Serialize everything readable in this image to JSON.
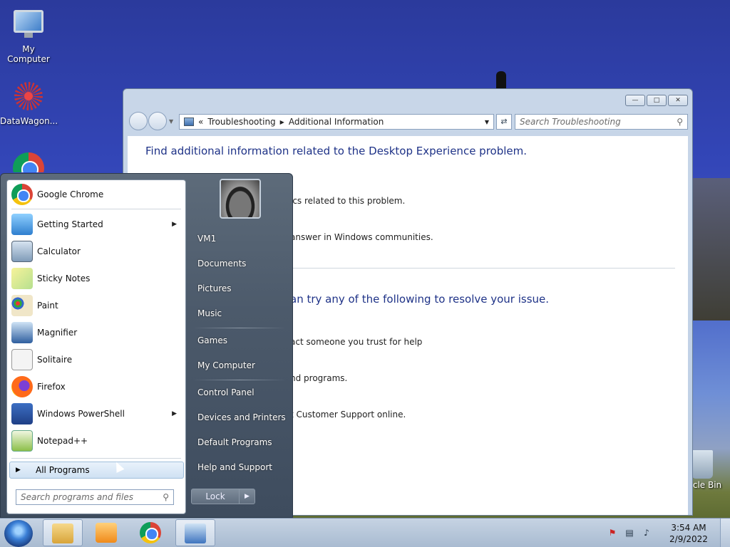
{
  "desktop": {
    "icons": [
      {
        "label": "My Computer"
      },
      {
        "label": "DataWagon..."
      },
      {
        "label": "Recycle Bin partial",
        "visible_text": "cle Bin"
      }
    ]
  },
  "explorer": {
    "breadcrumb": [
      "Troubleshooting",
      "Additional Information"
    ],
    "breadcrumb_sep": "«",
    "search_placeholder": "Search Troubleshooting",
    "heading": "Find additional information related to the Desktop Experience problem.",
    "line1": "ics related to this problem.",
    "line2": "answer in Windows communities.",
    "heading2": "an try any of the following to resolve your issue.",
    "line3": "act someone you trust for help",
    "line4": "nd programs.",
    "line5": "t Customer Support online."
  },
  "start_menu": {
    "programs": [
      {
        "label": "Google Chrome",
        "icon": "chrome-icon",
        "submenu": false
      },
      {
        "label": "Getting Started",
        "icon": "getting-started-icon",
        "submenu": true
      },
      {
        "label": "Calculator",
        "icon": "calculator-icon",
        "submenu": false
      },
      {
        "label": "Sticky Notes",
        "icon": "sticky-notes-icon",
        "submenu": false
      },
      {
        "label": "Paint",
        "icon": "paint-icon",
        "submenu": false
      },
      {
        "label": "Magnifier",
        "icon": "magnifier-icon",
        "submenu": false
      },
      {
        "label": "Solitaire",
        "icon": "solitaire-icon",
        "submenu": false
      },
      {
        "label": "Firefox",
        "icon": "firefox-icon",
        "submenu": false
      },
      {
        "label": "Windows PowerShell",
        "icon": "powershell-icon",
        "submenu": true
      },
      {
        "label": "Notepad++",
        "icon": "notepadpp-icon",
        "submenu": false
      }
    ],
    "all_programs": "All Programs",
    "search_placeholder": "Search programs and files",
    "right_items": [
      "VM1",
      "Documents",
      "Pictures",
      "Music",
      "Games",
      "My Computer",
      "Control Panel",
      "Devices and Printers",
      "Default Programs",
      "Help and Support"
    ],
    "lock_label": "Lock"
  },
  "taskbar": {
    "time": "3:54 AM",
    "date": "2/9/2022"
  },
  "colors": {
    "heading_blue": "#1e3287",
    "taskbar": "#b7c7da"
  }
}
